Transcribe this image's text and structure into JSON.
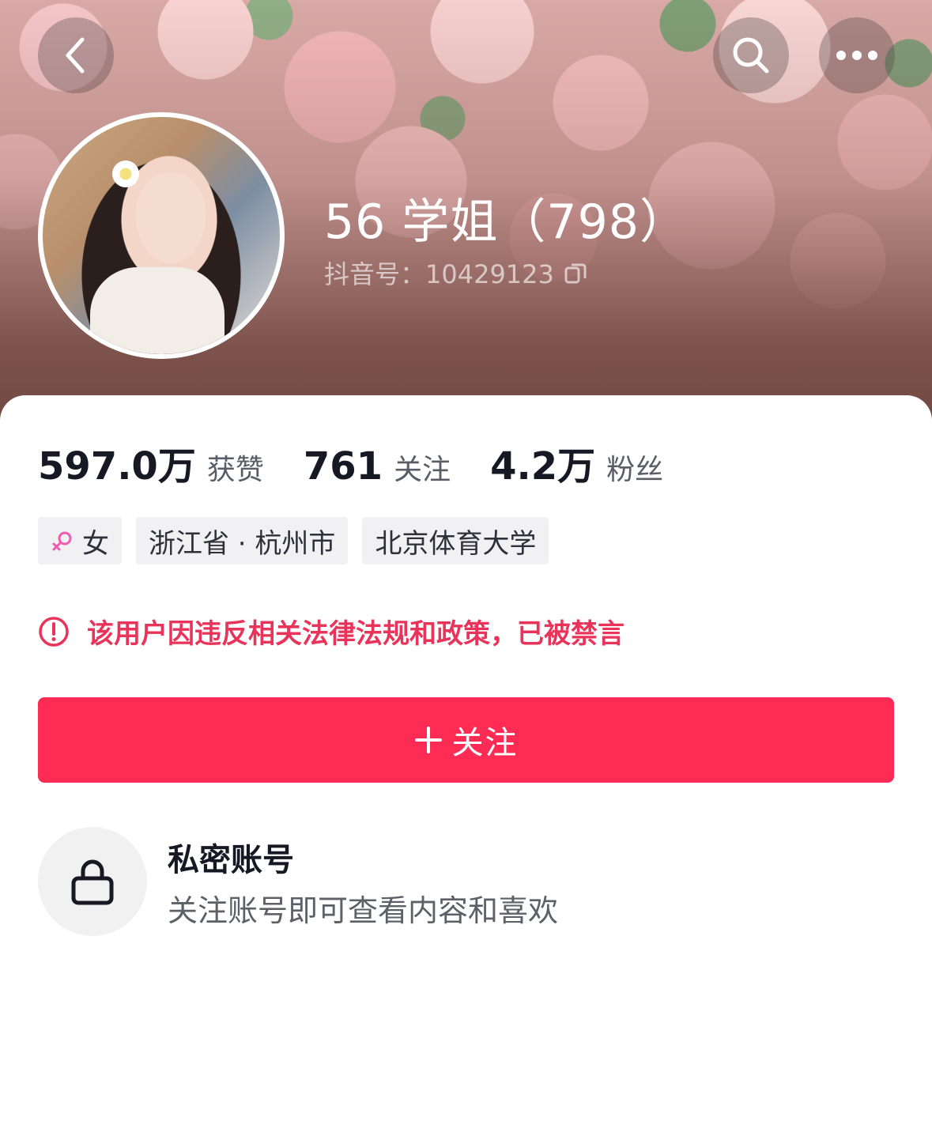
{
  "profile": {
    "name": "56 学姐（798）",
    "douyin_id": "抖音号：10429123"
  },
  "stats": [
    {
      "value": "597.0万",
      "label": "获赞"
    },
    {
      "value": "761",
      "label": "关注"
    },
    {
      "value": "4.2万",
      "label": "粉丝"
    }
  ],
  "tags": {
    "gender": "女",
    "location": "浙江省 · 杭州市",
    "school": "北京体育大学"
  },
  "warning_text": "该用户因违反相关法律法规和政策，已被禁言",
  "follow_button": {
    "label": "关注"
  },
  "private_account": {
    "title": "私密账号",
    "subtitle": "关注账号即可查看内容和喜欢"
  },
  "icons": {
    "back": "chevron-left-icon",
    "search": "search-icon",
    "more": "more-dots-icon",
    "copy": "copy-icon",
    "gender": "female-icon",
    "warning": "alert-circle-icon",
    "plus": "plus-icon",
    "lock": "lock-icon"
  },
  "colors": {
    "accent": "#fe2c55",
    "warning": "#e8345a",
    "female": "#f05ab3"
  }
}
